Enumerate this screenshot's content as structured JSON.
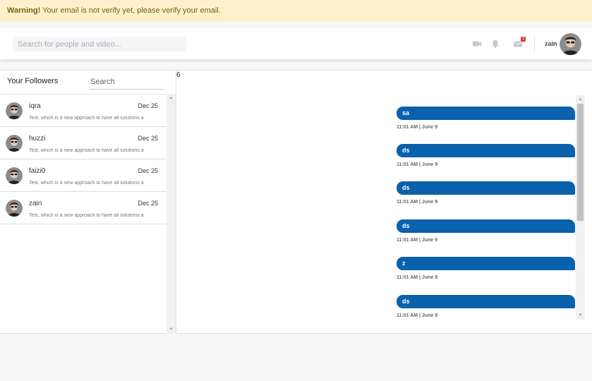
{
  "warning": {
    "strong": "Warning!",
    "text": " Your email is not verify yet, please verify your email."
  },
  "header": {
    "search_placeholder": "Search for people and video...",
    "icons": [
      "video-icon",
      "bell-icon",
      "envelope-icon"
    ],
    "mail_badge": "7",
    "username": "zain"
  },
  "followers": {
    "title": "Your Followers",
    "search_placeholder": "Search",
    "items": [
      {
        "name": "iqra",
        "date": "Dec 25",
        "preview": "Test, which is a new approach to have all solutions a"
      },
      {
        "name": "huzzi",
        "date": "Dec 25",
        "preview": "Test, which is a new approach to have all solutions a"
      },
      {
        "name": "faizi0",
        "date": "Dec 25",
        "preview": "Test, which is a new approach to have all solutions a"
      },
      {
        "name": "zain",
        "date": "Dec 25",
        "preview": "Test, which is a new approach to have all solutions a"
      }
    ]
  },
  "chat": {
    "count": "6",
    "messages": [
      {
        "text": "sa",
        "time": "11:01 AM | June 9"
      },
      {
        "text": "ds",
        "time": "11:01 AM | June 9"
      },
      {
        "text": "ds",
        "time": "11:01 AM | June 9"
      },
      {
        "text": "ds",
        "time": "11:01 AM | June 9"
      },
      {
        "text": "z",
        "time": "11:01 AM | June 9"
      },
      {
        "text": "ds",
        "time": "11:01 AM | June 9"
      }
    ]
  },
  "colors": {
    "bubble": "#0a61ac",
    "warning_bg": "#fdf1cc",
    "badge": "#e0344a"
  }
}
